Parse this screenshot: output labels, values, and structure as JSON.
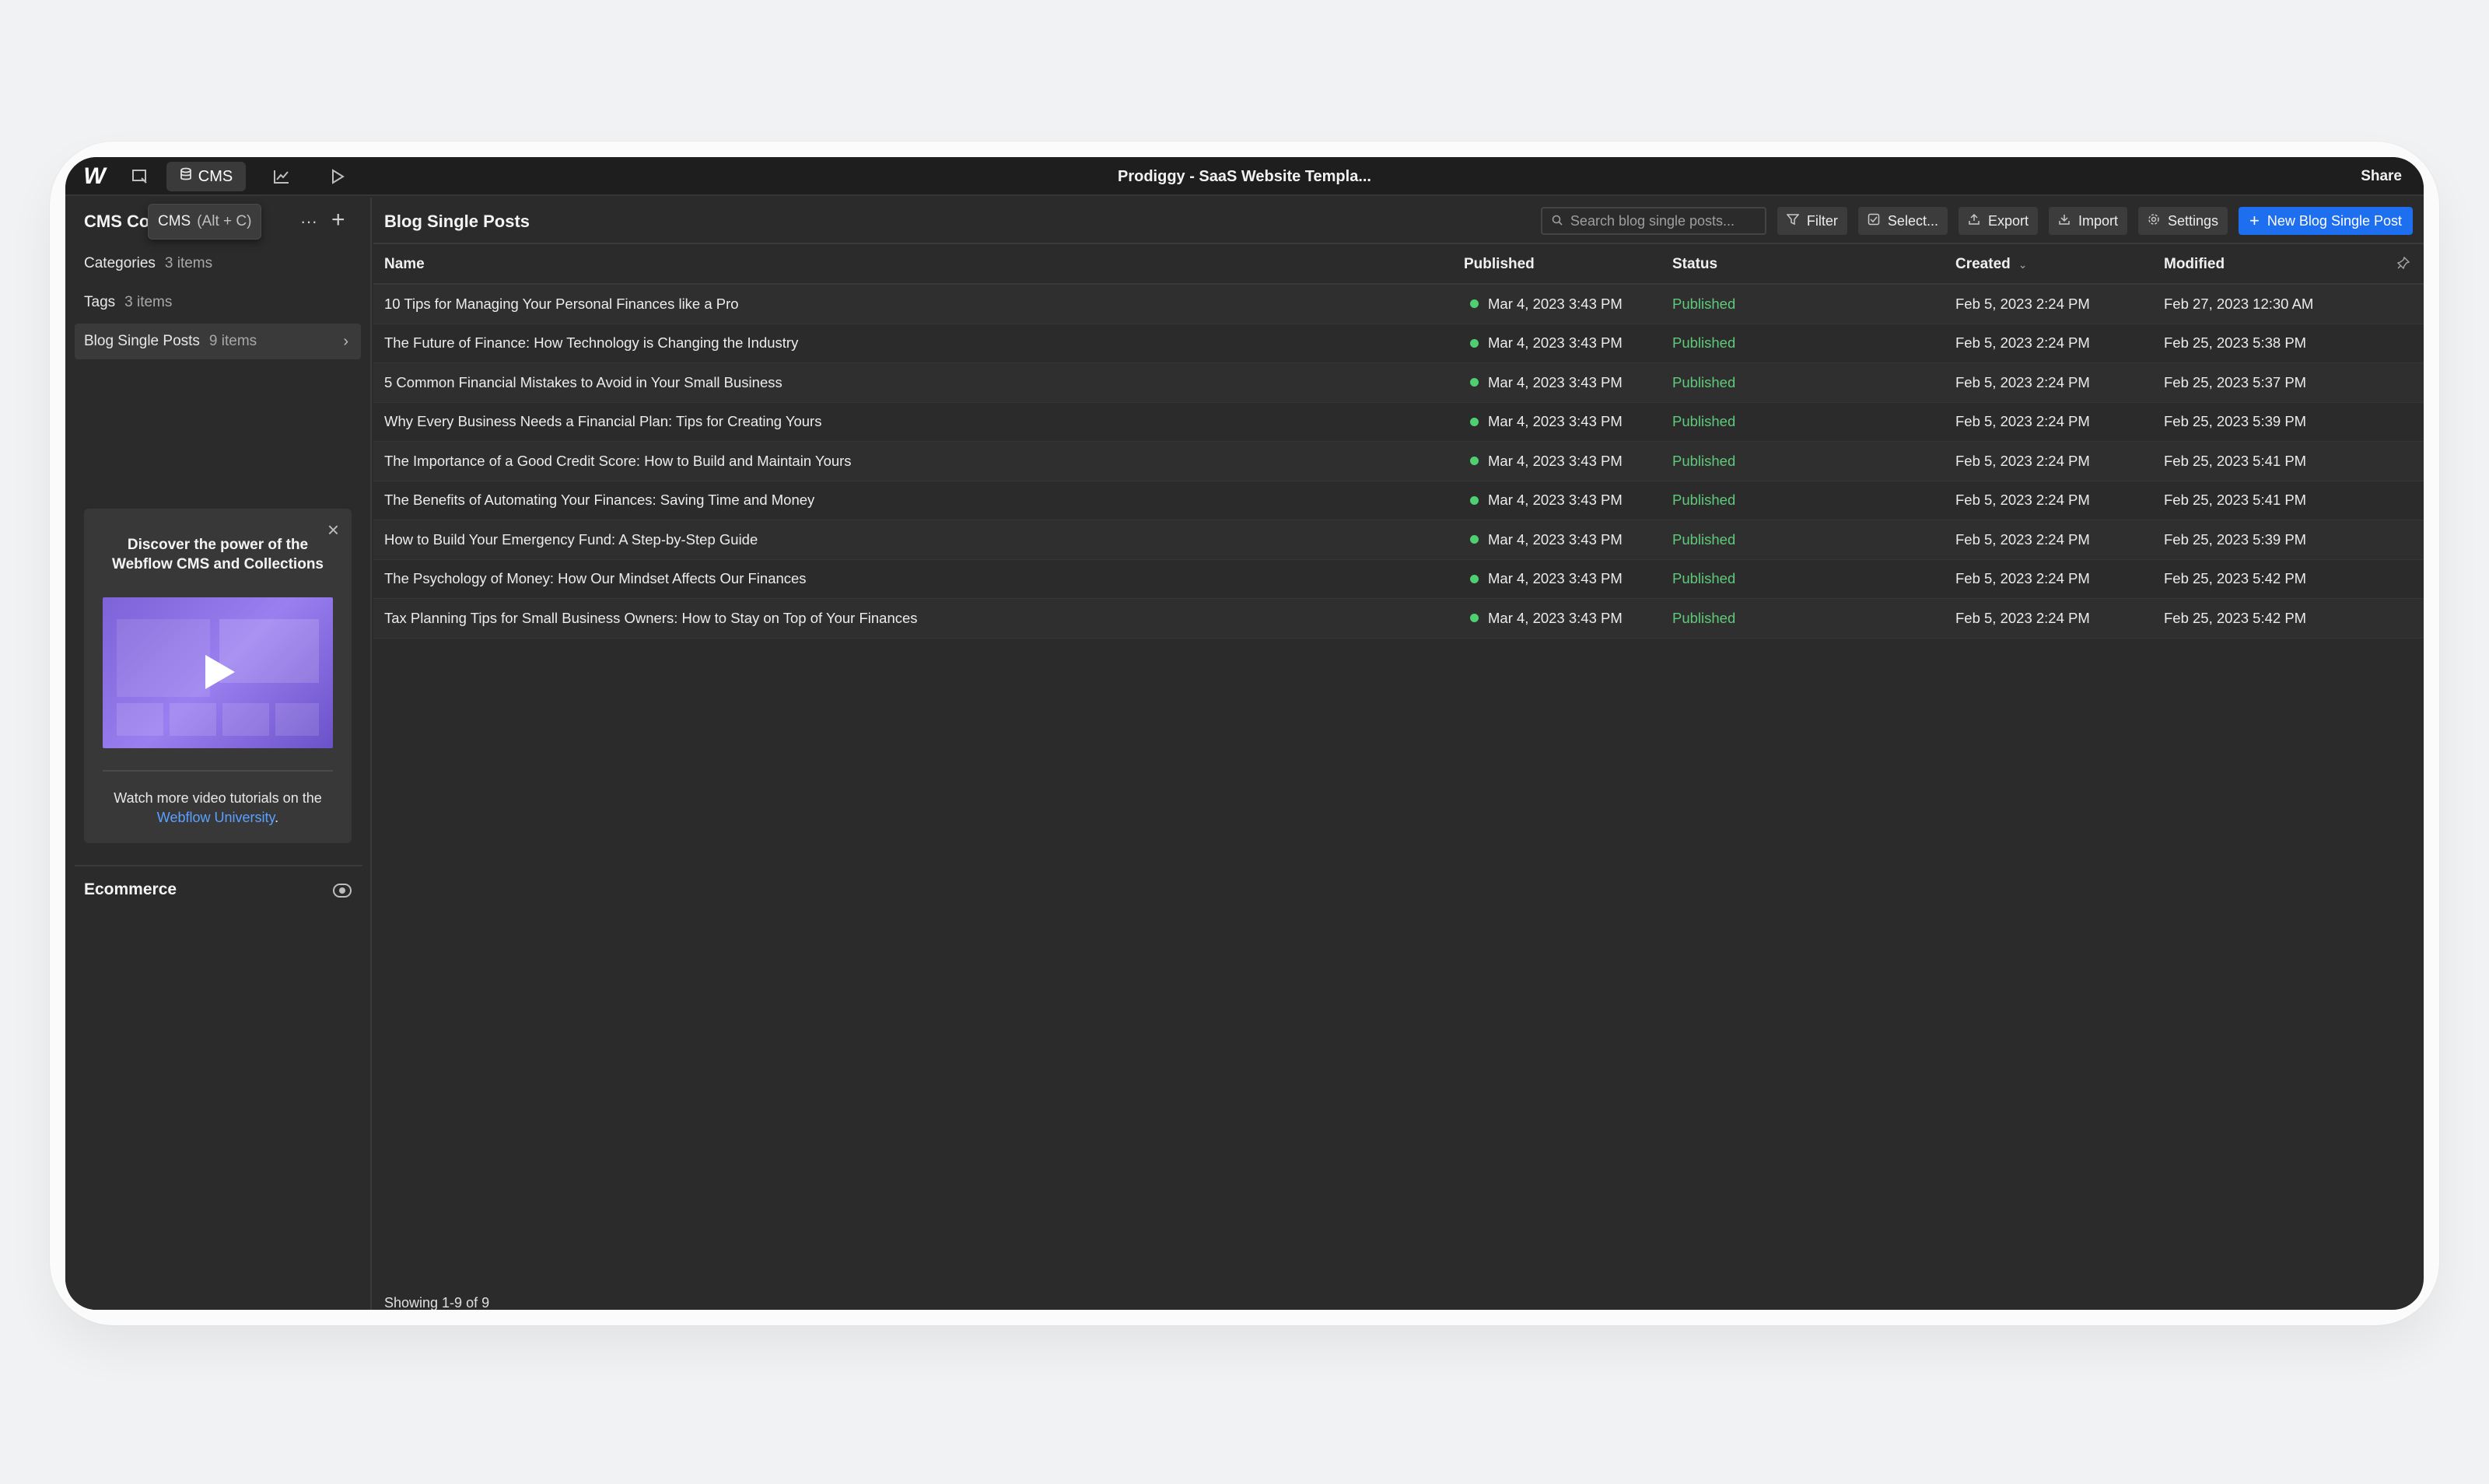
{
  "window": {
    "title": "Prodiggy - SaaS Website Templa...",
    "share_label": "Share",
    "cms_tab_label": "CMS"
  },
  "sidebar": {
    "heading": "CMS Col",
    "tooltip_label": "CMS",
    "tooltip_shortcut": "(Alt + C)",
    "more_label": "···",
    "add_label": "+",
    "collections": [
      {
        "label": "Categories",
        "count": "3 items"
      },
      {
        "label": "Tags",
        "count": "3 items"
      },
      {
        "label": "Blog Single Posts",
        "count": "9 items"
      }
    ],
    "promo": {
      "title": "Discover the power of the Webflow CMS and Collections",
      "footer_text": "Watch more video tutorials on the",
      "footer_link": "Webflow University",
      "footer_end": "."
    },
    "ecommerce_label": "Ecommerce"
  },
  "main": {
    "title": "Blog Single Posts",
    "search_placeholder": "Search blog single posts...",
    "toolbar": {
      "filter": "Filter",
      "select": "Select...",
      "export": "Export",
      "import": "Import",
      "settings": "Settings",
      "new_item": "New Blog Single Post"
    },
    "columns": {
      "name": "Name",
      "published": "Published",
      "status": "Status",
      "created": "Created",
      "modified": "Modified"
    },
    "rows": [
      {
        "name": "10 Tips for Managing Your Personal Finances like a Pro",
        "published": "Mar 4, 2023 3:43 PM",
        "status": "Published",
        "created": "Feb 5, 2023 2:24 PM",
        "modified": "Feb 27, 2023 12:30 AM"
      },
      {
        "name": "The Future of Finance: How Technology is Changing the Industry",
        "published": "Mar 4, 2023 3:43 PM",
        "status": "Published",
        "created": "Feb 5, 2023 2:24 PM",
        "modified": "Feb 25, 2023 5:38 PM"
      },
      {
        "name": "5 Common Financial Mistakes to Avoid in Your Small Business",
        "published": "Mar 4, 2023 3:43 PM",
        "status": "Published",
        "created": "Feb 5, 2023 2:24 PM",
        "modified": "Feb 25, 2023 5:37 PM"
      },
      {
        "name": "Why Every Business Needs a Financial Plan: Tips for Creating Yours",
        "published": "Mar 4, 2023 3:43 PM",
        "status": "Published",
        "created": "Feb 5, 2023 2:24 PM",
        "modified": "Feb 25, 2023 5:39 PM"
      },
      {
        "name": "The Importance of a Good Credit Score: How to Build and Maintain Yours",
        "published": "Mar 4, 2023 3:43 PM",
        "status": "Published",
        "created": "Feb 5, 2023 2:24 PM",
        "modified": "Feb 25, 2023 5:41 PM"
      },
      {
        "name": "The Benefits of Automating Your Finances: Saving Time and Money",
        "published": "Mar 4, 2023 3:43 PM",
        "status": "Published",
        "created": "Feb 5, 2023 2:24 PM",
        "modified": "Feb 25, 2023 5:41 PM"
      },
      {
        "name": "How to Build Your Emergency Fund: A Step-by-Step Guide",
        "published": "Mar 4, 2023 3:43 PM",
        "status": "Published",
        "created": "Feb 5, 2023 2:24 PM",
        "modified": "Feb 25, 2023 5:39 PM"
      },
      {
        "name": "The Psychology of Money: How Our Mindset Affects Our Finances",
        "published": "Mar 4, 2023 3:43 PM",
        "status": "Published",
        "created": "Feb 5, 2023 2:24 PM",
        "modified": "Feb 25, 2023 5:42 PM"
      },
      {
        "name": "Tax Planning Tips for Small Business Owners: How to Stay on Top of Your Finances",
        "published": "Mar 4, 2023 3:43 PM",
        "status": "Published",
        "created": "Feb 5, 2023 2:24 PM",
        "modified": "Feb 25, 2023 5:42 PM"
      }
    ],
    "footer": "Showing 1-9 of 9"
  },
  "colors": {
    "accent": "#1e6ff0",
    "status_published": "#5fca7a",
    "published_dot": "#4fcf72",
    "link": "#5aa1ff"
  },
  "icons": [
    "webflow-logo-icon",
    "designer-icon",
    "database-icon",
    "analytics-icon",
    "play-icon",
    "search-icon",
    "filter-icon",
    "checkbox-icon",
    "export-icon",
    "import-icon",
    "gear-icon",
    "plus-icon",
    "chevron-right-icon",
    "close-icon",
    "sort-down-icon",
    "pin-icon",
    "toggle-icon"
  ]
}
